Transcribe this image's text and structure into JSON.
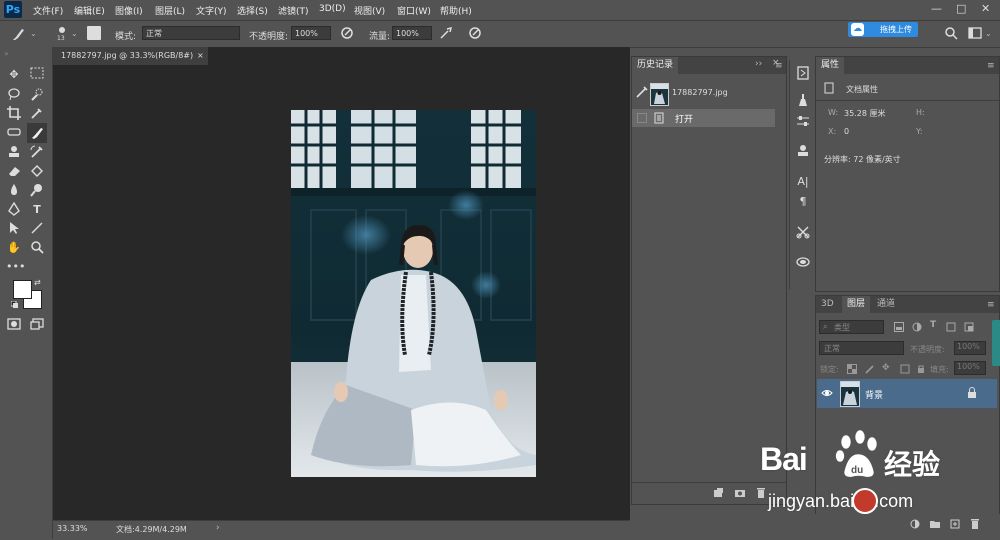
{
  "menu": {
    "logo": "Ps",
    "items": [
      "文件(F)",
      "编辑(E)",
      "图像(I)",
      "图层(L)",
      "文字(Y)",
      "选择(S)",
      "滤镜(T)",
      "3D(D)",
      "视图(V)",
      "窗口(W)",
      "帮助(H)"
    ],
    "window_controls": [
      "—",
      "□",
      "✕"
    ]
  },
  "options": {
    "brush_size": "13",
    "mode_label": "模式:",
    "mode_value": "正常",
    "opacity_label": "不透明度:",
    "opacity_value": "100%",
    "flow_label": "流量:",
    "flow_value": "100%",
    "cloud_button": "拖拽上传"
  },
  "document": {
    "tab_label": "17882797.jpg @ 33.3%(RGB/8#)",
    "tab_close": "×"
  },
  "status_bar": {
    "zoom": "33.33%",
    "doc_info": "文档:4.29M/4.29M",
    "arrow": "›"
  },
  "history": {
    "title": "历史记录",
    "snapshot_name": "17882797.jpg",
    "step": "打开"
  },
  "properties": {
    "title": "属性",
    "doc_props": "文档属性",
    "w_label": "W:",
    "w_value": "35.28 厘米",
    "h_label": "H:",
    "x_label": "X:",
    "x_value": "0",
    "y_label": "Y:",
    "resolution": "分辨率: 72 像素/英寸"
  },
  "layers": {
    "tabs": [
      "3D",
      "图层",
      "通道"
    ],
    "filter_type": "类型",
    "blend_mode": "正常",
    "opacity_label": "不透明度:",
    "opacity_value": "100%",
    "lock_label": "锁定:",
    "fill_label": "填充:",
    "fill_value": "100%",
    "layer_name": "背景"
  },
  "watermark": {
    "brand": "Bai",
    "brand_cn": "经验",
    "url": "jingyan.baidu.com"
  },
  "colors": {
    "ui_bg": "#535353",
    "canvas_bg": "#282828",
    "panel_dark": "#434343",
    "selection": "#4b6b8c",
    "accent": "#2f8be0"
  }
}
